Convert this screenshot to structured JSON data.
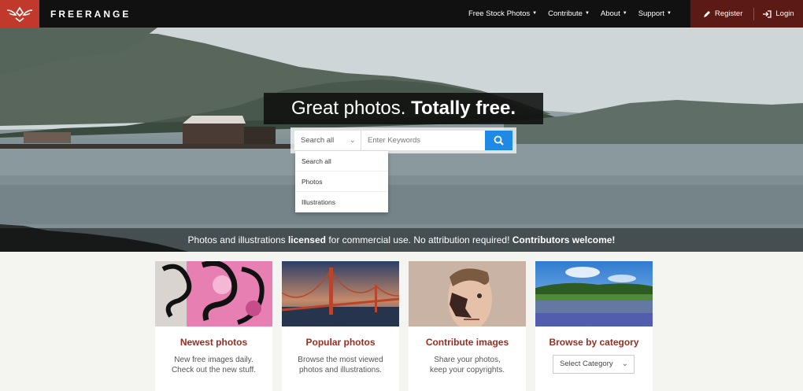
{
  "brand": {
    "name": "FREERANGE",
    "logo_color": "#c0392b"
  },
  "nav": {
    "items": [
      {
        "label": "Free Stock Photos"
      },
      {
        "label": "Contribute"
      },
      {
        "label": "About"
      },
      {
        "label": "Support"
      }
    ],
    "register": "Register",
    "login": "Login"
  },
  "hero": {
    "title_regular": "Great photos.",
    "title_bold": "Totally free.",
    "search": {
      "category_value": "Search all",
      "placeholder": "Enter Keywords",
      "dropdown": [
        "Search all",
        "Photos",
        "Illustrations"
      ]
    },
    "tagline": {
      "part1": "Photos and illustrations ",
      "bold1": "licensed",
      "part2": " for commercial use. No attribution required! ",
      "bold2": "Contributors welcome!"
    }
  },
  "cards": [
    {
      "title": "Newest photos",
      "desc1": "New free images daily.",
      "desc2": "Check out the new stuff."
    },
    {
      "title": "Popular photos",
      "desc1": "Browse the most viewed",
      "desc2": "photos and illustrations."
    },
    {
      "title": "Contribute images",
      "desc1": "Share your photos,",
      "desc2": "keep your copyrights."
    },
    {
      "title": "Browse by category",
      "select_value": "Select Category"
    }
  ],
  "colors": {
    "accent": "#9b2d20",
    "search_button": "#1e8ae6",
    "navbar": "#111111",
    "auth_bg": "#5b1b14"
  }
}
